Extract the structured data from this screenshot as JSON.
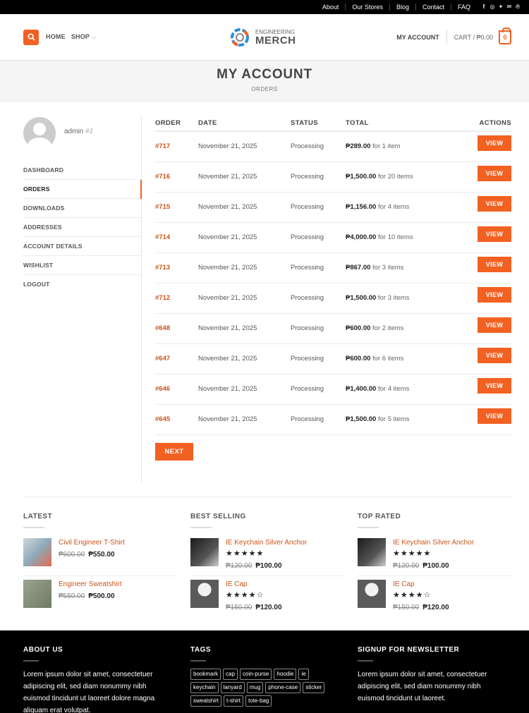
{
  "topbar": {
    "links": [
      "About",
      "Our Stores",
      "Blog",
      "Contact",
      "FAQ"
    ],
    "social_icons": [
      "facebook-icon",
      "instagram-icon",
      "twitter-icon",
      "email-icon",
      "pinterest-icon"
    ]
  },
  "header": {
    "nav": {
      "home": "HOME",
      "shop": "SHOP"
    },
    "logo": {
      "line1": "ENGINEERING",
      "line2": "MERCH"
    },
    "my_account": "MY ACCOUNT",
    "cart": "CART / ₱0.00",
    "cart_count": "0",
    "accent": "#f26122"
  },
  "page_title": {
    "title": "MY ACCOUNT",
    "subtitle": "ORDERS"
  },
  "sidebar": {
    "username": "admin",
    "user_id": "#1",
    "menu": [
      "DASHBOARD",
      "ORDERS",
      "DOWNLOADS",
      "ADDRESSES",
      "ACCOUNT DETAILS",
      "WISHLIST",
      "LOGOUT"
    ],
    "active": "ORDERS"
  },
  "orders": {
    "headers": {
      "order": "ORDER",
      "date": "DATE",
      "status": "STATUS",
      "total": "TOTAL",
      "actions": "ACTIONS"
    },
    "view_label": "VIEW",
    "next_label": "NEXT",
    "rows": [
      {
        "order": "#717",
        "date": "November 21, 2025",
        "status": "Processing",
        "amount": "₱289.00",
        "items": " for 1 item"
      },
      {
        "order": "#716",
        "date": "November 21, 2025",
        "status": "Processing",
        "amount": "₱1,500.00",
        "items": " for 20 items"
      },
      {
        "order": "#715",
        "date": "November 21, 2025",
        "status": "Processing",
        "amount": "₱1,156.00",
        "items": " for 4 items"
      },
      {
        "order": "#714",
        "date": "November 21, 2025",
        "status": "Processing",
        "amount": "₱4,000.00",
        "items": " for 10 items"
      },
      {
        "order": "#713",
        "date": "November 21, 2025",
        "status": "Processing",
        "amount": "₱867.00",
        "items": " for 3 items"
      },
      {
        "order": "#712",
        "date": "November 21, 2025",
        "status": "Processing",
        "amount": "₱1,500.00",
        "items": " for 3 items"
      },
      {
        "order": "#648",
        "date": "November 21, 2025",
        "status": "Processing",
        "amount": "₱600.00",
        "items": " for 2 items"
      },
      {
        "order": "#647",
        "date": "November 21, 2025",
        "status": "Processing",
        "amount": "₱600.00",
        "items": " for 6 items"
      },
      {
        "order": "#646",
        "date": "November 21, 2025",
        "status": "Processing",
        "amount": "₱1,400.00",
        "items": " for 4 items"
      },
      {
        "order": "#645",
        "date": "November 21, 2025",
        "status": "Processing",
        "amount": "₱1,500.00",
        "items": " for 5 items"
      }
    ]
  },
  "widgets": {
    "latest": {
      "title": "LATEST",
      "products": [
        {
          "name": "Civil Engineer T-Shirt",
          "old_price": "₱600.00",
          "price": "₱550.00"
        },
        {
          "name": "Engineer Sweatshirt",
          "old_price": "₱550.00",
          "price": "₱500.00"
        }
      ]
    },
    "best_selling": {
      "title": "BEST SELLING",
      "products": [
        {
          "name": "IE Keychain Silver Anchor",
          "stars": "★★★★★",
          "rating": 5,
          "old_price": "₱120.00",
          "price": "₱100.00"
        },
        {
          "name": "IE Cap",
          "stars": "★★★★☆",
          "rating": 4,
          "old_price": "₱150.00",
          "price": "₱120.00"
        }
      ]
    },
    "top_rated": {
      "title": "TOP RATED",
      "products": [
        {
          "name": "IE Keychain Silver Anchor",
          "stars": "★★★★★",
          "rating": 5,
          "old_price": "₱120.00",
          "price": "₱100.00"
        },
        {
          "name": "IE Cap",
          "stars": "★★★★☆",
          "rating": 4,
          "old_price": "₱150.00",
          "price": "₱120.00"
        }
      ]
    }
  },
  "footer": {
    "about": {
      "title": "ABOUT US",
      "text": "Lorem ipsum dolor sit amet, consectetuer adipiscing elit, sed diam nonummy nibh euismod tincidunt ut laoreet dolore magna aliquam erat volutpat."
    },
    "tags": {
      "title": "TAGS",
      "items": [
        "bookmark",
        "cap",
        "coin-purse",
        "hoodie",
        "ie",
        "keychain",
        "lanyard",
        "mug",
        "phone-case",
        "sticker",
        "sweatshirt",
        "t-shirt",
        "tote-bag"
      ]
    },
    "newsletter": {
      "title": "SIGNUP FOR NEWSLETTER",
      "text": "Lorem ipsum dolor sit amet, consectetuer adipiscing elit, sed diam nonummy nibh euismod tincidunt ut laoreet."
    }
  }
}
